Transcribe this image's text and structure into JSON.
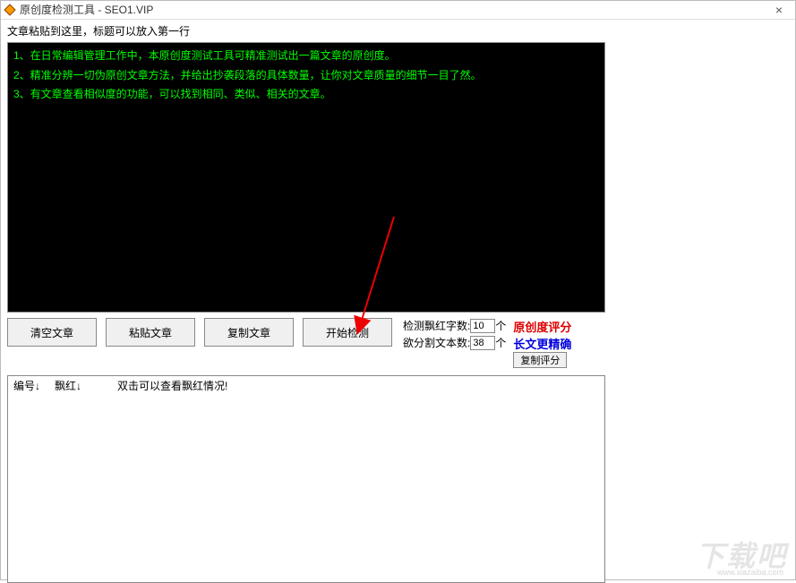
{
  "window": {
    "title": "原创度检测工具 - SEO1.VIP"
  },
  "instruction": "文章粘贴到这里，标题可以放入第一行",
  "editor_lines": [
    "1、在日常编辑管理工作中，本原创度测试工具可精准测试出一篇文章的原创度。",
    "2、精准分辨一切伪原创文章方法，并给出抄袭段落的具体数量，让你对文章质量的细节一目了然。",
    "3、有文章查看相似度的功能，可以找到相同、类似、相关的文章。"
  ],
  "buttons": {
    "clear": "清空文章",
    "paste": "粘贴文章",
    "copy": "复制文章",
    "start": "开始检测",
    "copy_score": "复制评分"
  },
  "params": {
    "detect_label": "检测飘红字数:",
    "detect_value": "10",
    "detect_unit": "个",
    "split_label": "欲分割文本数:",
    "split_value": "38",
    "split_unit": "个"
  },
  "score": {
    "line1": "原创度评分",
    "line2": "长文更精确"
  },
  "results": {
    "col1": "编号↓",
    "col2": "飘红↓",
    "hint": "双击可以查看飘红情况!"
  },
  "watermark": {
    "main": "下载吧",
    "sub": "www.xiazaiba.com"
  }
}
